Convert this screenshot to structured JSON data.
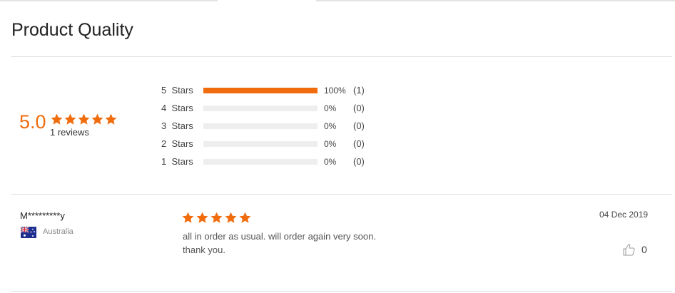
{
  "page_title": "Product Quality",
  "summary": {
    "score": "5.0",
    "rating_stars": 5,
    "review_count_text": "1 reviews",
    "accent_color": "#f06c0d"
  },
  "distribution": [
    {
      "label": "5  Stars",
      "fraction": 1.0,
      "percent": "100%",
      "count": "(1)"
    },
    {
      "label": "4  Stars",
      "fraction": 0.0,
      "percent": "0%",
      "count": "(0)"
    },
    {
      "label": "3  Stars",
      "fraction": 0.0,
      "percent": "0%",
      "count": "(0)"
    },
    {
      "label": "2  Stars",
      "fraction": 0.0,
      "percent": "0%",
      "count": "(0)"
    },
    {
      "label": "1  Stars",
      "fraction": 0.0,
      "percent": "0%",
      "count": "(0)"
    }
  ],
  "review": {
    "reviewer": "M*********y",
    "country": "Australia",
    "flag_icon": "australia-flag-icon",
    "rating_stars": 5,
    "text_line1": "all in order as usual. will order again very soon.",
    "text_line2": "thank you.",
    "date": "04 Dec 2019",
    "helpful_icon": "thumbs-up-icon",
    "helpful_count": "0"
  }
}
